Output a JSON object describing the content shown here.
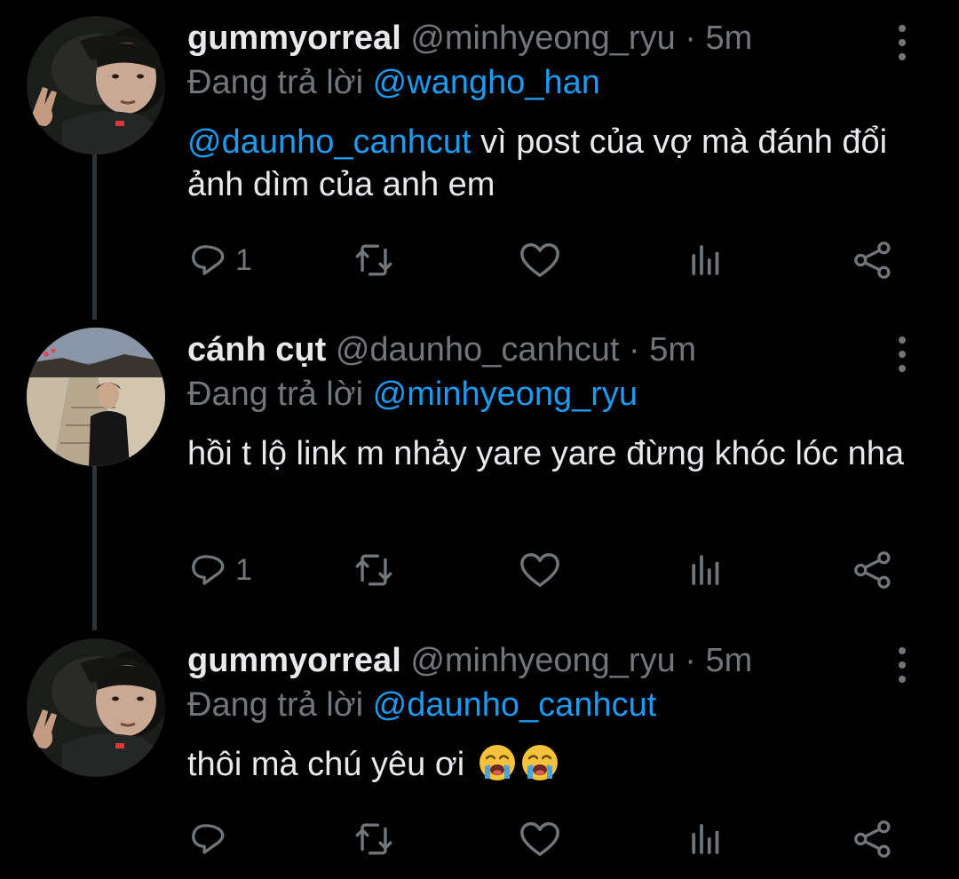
{
  "colors": {
    "background": "#000000",
    "text_primary": "#e7e9ea",
    "text_secondary": "#71767b",
    "mention": "#1d9bf0",
    "thread_line": "#2f3336"
  },
  "tweets": [
    {
      "display_name": "gummyorreal",
      "handle": "@minhyeong_ryu",
      "separator": "·",
      "time": "5m",
      "reply_prefix": "Đang trả lời",
      "reply_to": "@wangho_han",
      "body_mention": "@daunho_canhcut",
      "body_text": " vì post của vợ mà đánh đổi ảnh dìm của anh em",
      "reply_count": "1",
      "avatar_icon": "user-avatar-peace-sign"
    },
    {
      "display_name": "cánh cụt",
      "handle": "@daunho_canhcut",
      "separator": "·",
      "time": "5m",
      "reply_prefix": "Đang trả lời",
      "reply_to": "@minhyeong_ryu",
      "body_text": "hồi t lộ link m nhảy yare yare đừng khóc lóc nha",
      "reply_count": "1",
      "avatar_icon": "user-avatar-outdoor-stairs"
    },
    {
      "display_name": "gummyorreal",
      "handle": "@minhyeong_ryu",
      "separator": "·",
      "time": "5m",
      "reply_prefix": "Đang trả lời",
      "reply_to": "@daunho_canhcut",
      "body_text": "thôi mà chú yêu ơi",
      "body_emoji": [
        "loudly-crying-face-emoji",
        "loudly-crying-face-emoji"
      ],
      "reply_count": "",
      "avatar_icon": "user-avatar-peace-sign"
    }
  ]
}
